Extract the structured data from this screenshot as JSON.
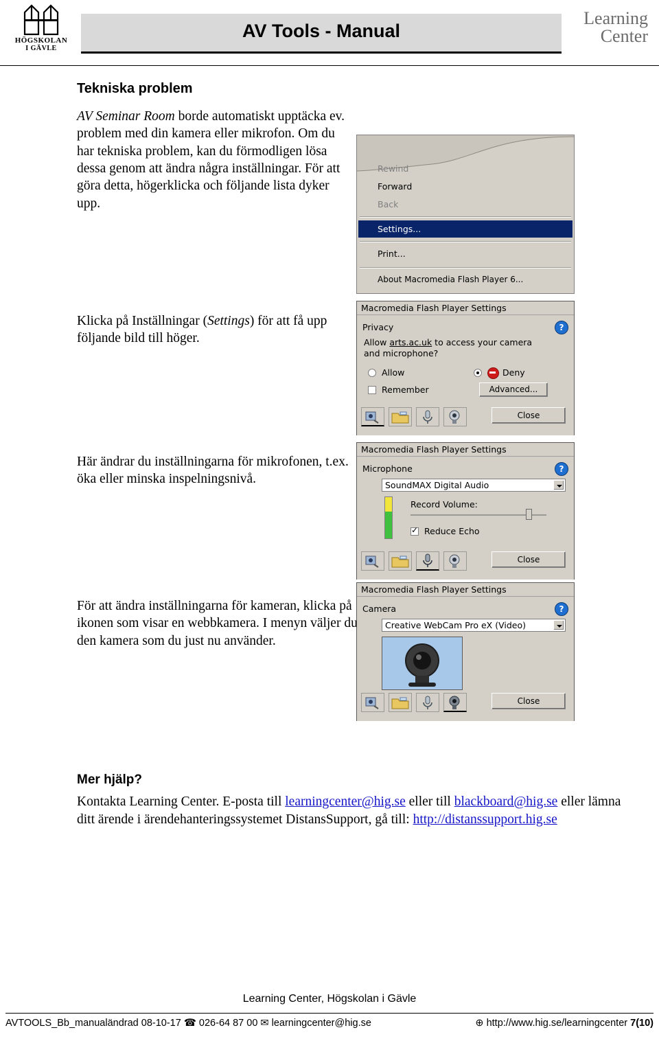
{
  "header": {
    "logo_line1": "HÖGSKOLAN",
    "logo_line2": "I GÄVLE",
    "title": "AV Tools - Manual",
    "lc_line1": "Learning",
    "lc_line2": "Center"
  },
  "main": {
    "section_title": "Tekniska problem",
    "para1_em": "AV Seminar Room",
    "para1_rest": " borde automatiskt upptäcka ev. problem med din kamera eller mikrofon. Om du har tekniska problem, kan du förmodligen lösa dessa genom att ändra några inställningar. För att göra detta, högerklicka och följande lista dyker upp.",
    "para2_a": "Klicka på Inställningar (",
    "para2_em": "Settings",
    "para2_b": ") för att få upp följande bild till höger.",
    "para3": "Här ändrar du inställningarna för mikrofonen, t.ex. öka eller minska inspelningsnivå.",
    "para4": "För att ändra inställningarna för kameran, klicka på ikonen som visar en webbkamera. I menyn väljer du den kamera som du just nu använder.",
    "help_title": "Mer hjälp?",
    "help_p1_a": "Kontakta Learning Center. E-posta till ",
    "help_link1": "learningcenter@hig.se",
    "help_p1_b": " eller till ",
    "help_link2": "blackboard@hig.se",
    "help_p1_c": " eller lämna ditt ärende i ärendehanteringssystemet DistansSupport, gå till: ",
    "help_link3": "http://distanssupport.hig.se"
  },
  "screenshots": {
    "context_menu": {
      "items": [
        {
          "label": "Rewind",
          "state": "dim"
        },
        {
          "label": "Forward",
          "state": "normal"
        },
        {
          "label": "Back",
          "state": "dim"
        },
        {
          "label": "Settings...",
          "state": "selected"
        },
        {
          "label": "Print...",
          "state": "normal"
        },
        {
          "label": "About Macromedia Flash Player 6...",
          "state": "normal"
        }
      ]
    },
    "privacy_dialog": {
      "title": "Macromedia Flash Player Settings",
      "section": "Privacy",
      "help_glyph": "?",
      "text_line1_a": "Allow ",
      "text_link": "arts.ac.uk",
      "text_line1_b": " to access your camera",
      "text_line2": "and microphone?",
      "allow_label": "Allow",
      "deny_label": "Deny",
      "remember_label": "Remember",
      "advanced_label": "Advanced...",
      "close_label": "Close",
      "allow_checked": false,
      "deny_checked": true,
      "remember_checked": false
    },
    "microphone_dialog": {
      "title": "Macromedia Flash Player Settings",
      "section": "Microphone",
      "help_glyph": "?",
      "device": "SoundMAX Digital Audio",
      "record_volume_label": "Record Volume:",
      "reduce_echo_label": "Reduce Echo",
      "reduce_echo_checked": true,
      "close_label": "Close"
    },
    "camera_dialog": {
      "title": "Macromedia Flash Player Settings",
      "section": "Camera",
      "help_glyph": "?",
      "device": "Creative WebCam Pro eX (Video)",
      "close_label": "Close"
    },
    "tab_icons": [
      "privacy-icon",
      "storage-icon",
      "microphone-icon",
      "camera-icon"
    ]
  },
  "footer": {
    "center": "Learning Center, Högskolan i Gävle",
    "left_doc": "AVTOOLS_Bb_manualändrad 08-10-17",
    "phone_glyph": "☎",
    "phone": "026-64 87 00",
    "mail_glyph": "✉",
    "email": "learningcenter@hig.se",
    "globe_glyph": "⊕",
    "url": "http://www.hig.se/learningcenter",
    "page": "7(10)"
  },
  "colors": {
    "title_bar_bg": "#d9d9d9",
    "lc_gray": "#6b6b6b",
    "link_blue": "#1414c8",
    "menu_select": "#0a246a",
    "dialog_face": "#d4d0c8"
  }
}
